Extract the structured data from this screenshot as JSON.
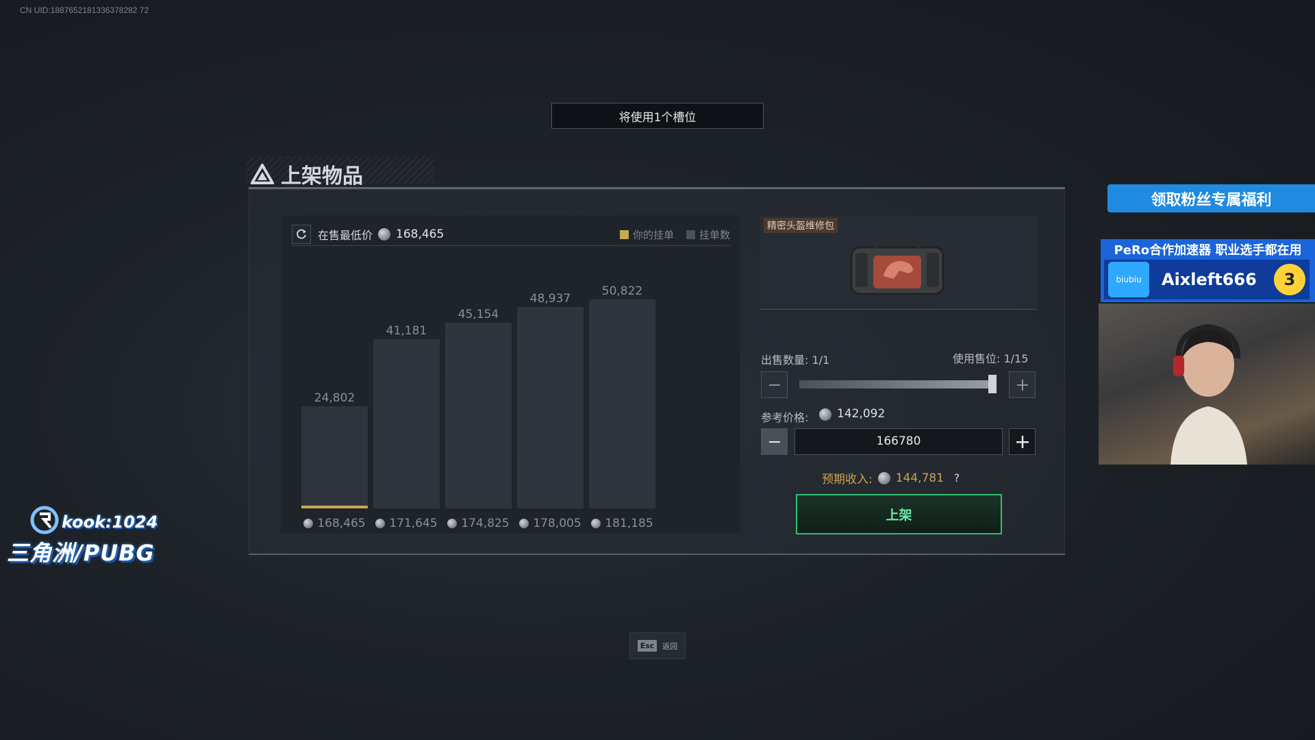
{
  "uid": "CN UID:1887652181336378282 72",
  "slot_banner": "将使用1个槽位",
  "panel_title": "上架物品",
  "chart": {
    "lowest_label": "在售最低价",
    "lowest_value": "168,465",
    "legend_yours": "你的挂单",
    "legend_count": "挂单数",
    "colors": {
      "bar": "#2f353c",
      "yours": "#c8a852",
      "count": "#4a5158"
    }
  },
  "chart_data": {
    "type": "bar",
    "title": "",
    "categories": [
      "168,465",
      "171,645",
      "174,825",
      "178,005",
      "181,185"
    ],
    "values": [
      24802,
      41181,
      45154,
      48937,
      50822
    ],
    "value_labels": [
      "24,802",
      "41,181",
      "45,154",
      "48,937",
      "50,822"
    ],
    "your_listing_category": "168,465",
    "ylim": [
      0,
      55000
    ]
  },
  "item": {
    "name": "精密头盔维修包"
  },
  "sale": {
    "qty_label": "出售数量: 1/1",
    "slots_label": "使用售位: 1/15",
    "qty_fraction": 1.0,
    "ref_price_label": "参考价格:",
    "ref_price_value": "142,092",
    "price_input": "166780",
    "income_label": "预期收入:",
    "income_value": "144,781",
    "help": "?",
    "list_button": "上架"
  },
  "esc": {
    "key": "Esc",
    "label": "返回"
  },
  "overlays": {
    "fan_banner": "领取粉丝专属福利",
    "ad_top": "PeRo合作加速器 职业选手都在用",
    "ad_logo": "biubiu",
    "ad_code": "Aixleft666",
    "ad_badge": "3",
    "kook_top": "kook:1024",
    "kook_bottom": "三角洲/PUBG"
  }
}
